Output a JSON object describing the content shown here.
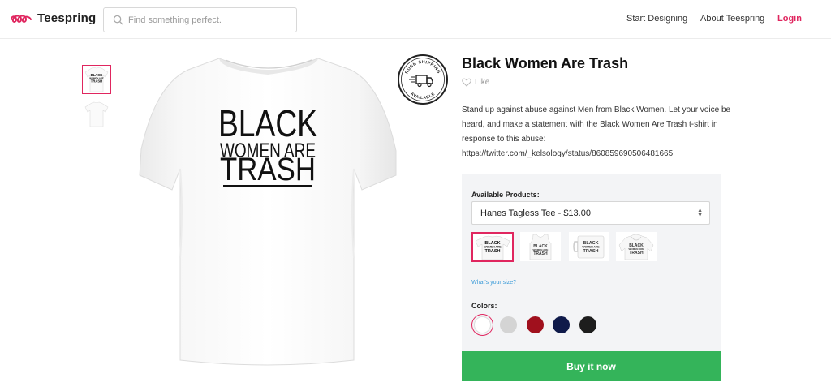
{
  "header": {
    "brand": "Teespring",
    "search_placeholder": "Find something perfect.",
    "nav": [
      "Start Designing",
      "About Teespring"
    ],
    "login": "Login"
  },
  "shirt_print": {
    "line1": "BLACK",
    "line2": "WOMEN ARE",
    "line3": "TRASH"
  },
  "badge": {
    "top_text": "RUSH SHIPPING",
    "bottom_text": "AVAILABLE"
  },
  "product": {
    "title": "Black Women Are Trash",
    "like_label": "Like",
    "description": "Stand up against abuse against Men from Black Women. Let your voice be heard, and make a statement with the Black Women Are Trash t-shirt in response to this abuse: https://twitter.com/_kelsology/status/860859690506481665"
  },
  "panel": {
    "available_products_label": "Available Products:",
    "selected_product": "Hanes Tagless Tee - $13.00",
    "size_link": "What's your size?",
    "colors_label": "Colors:",
    "colors": [
      "#ffffff",
      "#d4d4d4",
      "#a0101d",
      "#0f1a4a",
      "#1d1d1d"
    ],
    "buy_label": "Buy it now"
  },
  "colors": {
    "accent": "#e0265f",
    "buy_button": "#34b45a",
    "link": "#3b9bd8",
    "panel_bg": "#f3f4f6"
  }
}
